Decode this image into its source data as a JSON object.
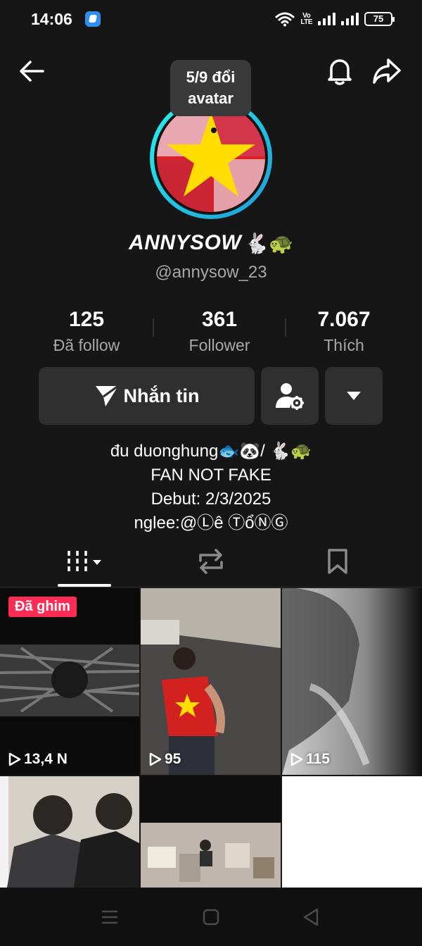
{
  "status_bar": {
    "time": "14:06",
    "network_label": "VoLTE",
    "network_label_line1": "Vo",
    "network_label_line2": "LTE",
    "battery": "75"
  },
  "header": {
    "back_icon": "arrow-left-icon",
    "bell_icon": "bell-icon",
    "share_icon": "share-arrow-icon"
  },
  "avatar": {
    "tooltip": "5/9 đổi avatar",
    "tooltip_line1": "5/9 đổi",
    "tooltip_line2": "avatar",
    "ring_colors": [
      "#25f4ee",
      "#25a5e0"
    ]
  },
  "profile": {
    "display_name": "ANNYSOW",
    "name_emojis": "🐇🐢",
    "username": "@annysow_23"
  },
  "stats": [
    {
      "value": "125",
      "label": "Đã follow"
    },
    {
      "value": "361",
      "label": "Follower"
    },
    {
      "value": "7.067",
      "label": "Thích"
    }
  ],
  "actions": {
    "message_label": "Nhắn tin",
    "add_friend_icon": "user-settings-icon",
    "more_icon": "caret-down-icon"
  },
  "bio": {
    "line1": "đu duonghung🐟🐼/ 🐇🐢",
    "line2": "FAN NOT FAKE",
    "line3": "Debut: 2/3/2025",
    "line4": "nglee:@Ⓛê ⓉổⓃⒼ"
  },
  "tabs": [
    {
      "name": "videos",
      "icon": "grid-icon"
    },
    {
      "name": "reposts",
      "icon": "repost-icon"
    },
    {
      "name": "saved",
      "icon": "bookmark-icon"
    }
  ],
  "videos": [
    {
      "pinned_label": "Đã ghim",
      "views": "13,4 N"
    },
    {
      "views": "95"
    },
    {
      "views": "115"
    },
    {
      "views": ""
    },
    {
      "views": ""
    },
    {
      "views": ""
    }
  ],
  "colors": {
    "background": "#161616",
    "button": "#2f2f2f",
    "pin_badge": "#fe2c55",
    "muted_text": "#a8a8a8"
  }
}
